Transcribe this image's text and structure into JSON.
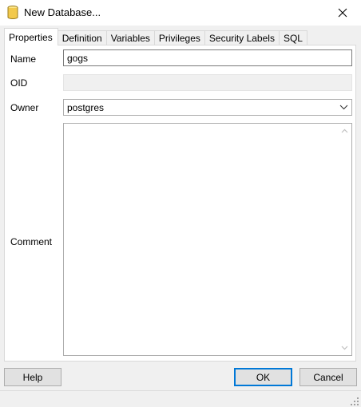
{
  "window": {
    "title": "New Database..."
  },
  "tabs": [
    {
      "label": "Properties",
      "active": true
    },
    {
      "label": "Definition",
      "active": false
    },
    {
      "label": "Variables",
      "active": false
    },
    {
      "label": "Privileges",
      "active": false
    },
    {
      "label": "Security Labels",
      "active": false
    },
    {
      "label": "SQL",
      "active": false
    }
  ],
  "form": {
    "name_label": "Name",
    "name_value": "gogs",
    "oid_label": "OID",
    "oid_value": "",
    "owner_label": "Owner",
    "owner_value": "postgres",
    "comment_label": "Comment",
    "comment_value": ""
  },
  "buttons": {
    "help": "Help",
    "ok": "OK",
    "cancel": "Cancel"
  },
  "icons": {
    "app": "database-icon",
    "close": "close-icon",
    "dropdown": "chevron-down-icon",
    "scroll_up": "scroll-up-arrow-icon",
    "scroll_down": "scroll-down-arrow-icon",
    "resize": "resize-grip-icon"
  },
  "colors": {
    "window_bg": "#f0f0f0",
    "panel_bg": "#ffffff",
    "default_button_border": "#0078d7",
    "database_icon": "#f2c94c"
  }
}
